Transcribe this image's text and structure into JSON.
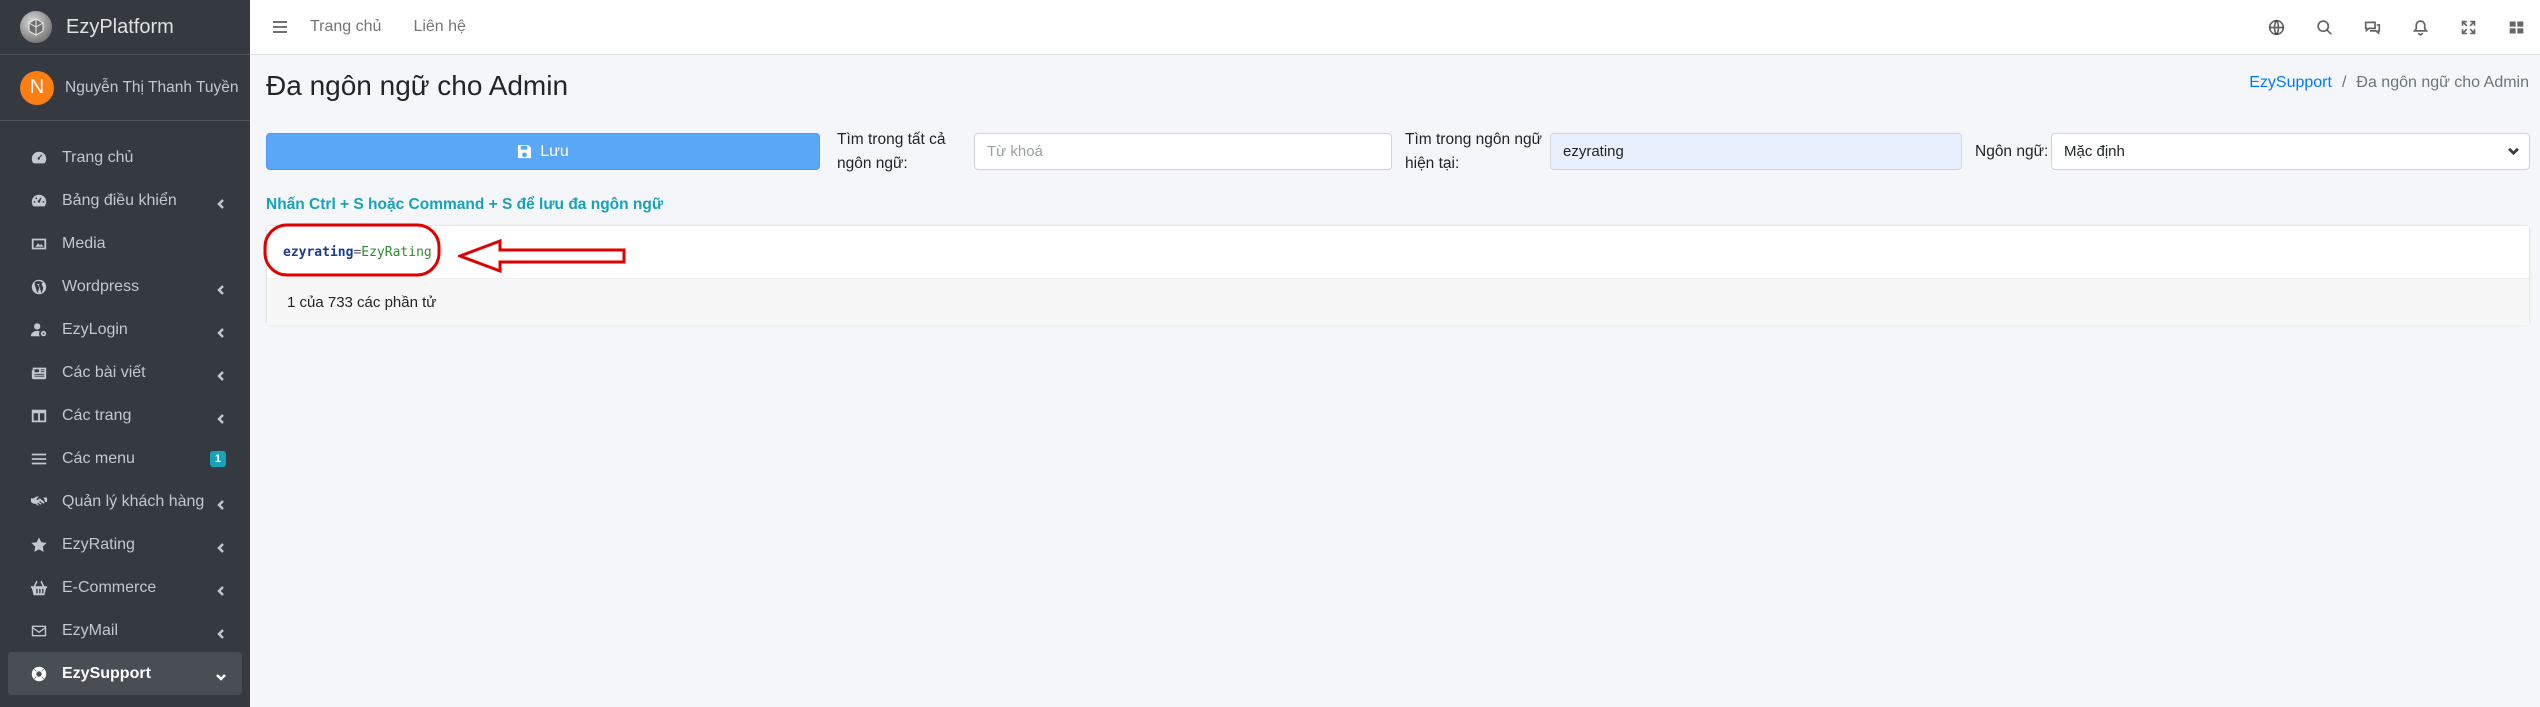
{
  "brand": {
    "name": "EzyPlatform"
  },
  "user": {
    "initial": "N",
    "name": "Nguyễn Thị Thanh Tuyền"
  },
  "sidebar": {
    "items": [
      {
        "label": "Trang chủ",
        "icon": "tachometer-icon"
      },
      {
        "label": "Bảng điều khiển",
        "icon": "dashboard-icon"
      },
      {
        "label": "Media",
        "icon": "image-icon"
      },
      {
        "label": "Wordpress",
        "icon": "wordpress-icon"
      },
      {
        "label": "EzyLogin",
        "icon": "user-cog-icon"
      },
      {
        "label": "Các bài viết",
        "icon": "newspaper-icon"
      },
      {
        "label": "Các trang",
        "icon": "columns-icon"
      },
      {
        "label": "Các menu",
        "icon": "bars-icon",
        "badge": "1"
      },
      {
        "label": "Quản lý khách hàng",
        "icon": "handshake-icon"
      },
      {
        "label": "EzyRating",
        "icon": "star-icon"
      },
      {
        "label": "E-Commerce",
        "icon": "basket-icon"
      },
      {
        "label": "EzyMail",
        "icon": "envelope-icon"
      },
      {
        "label": "EzySupport",
        "icon": "life-ring-icon"
      }
    ]
  },
  "navbar": {
    "links": [
      "Trang chủ",
      "Liên hệ"
    ],
    "icons": [
      "globe-icon",
      "search-icon",
      "comments-icon",
      "bell-icon",
      "expand-icon",
      "grid-icon"
    ]
  },
  "page": {
    "title": "Đa ngôn ngữ cho Admin",
    "breadcrumb": {
      "parent": "EzySupport",
      "separator": "/",
      "current": "Đa ngôn ngữ cho Admin"
    }
  },
  "toolbar": {
    "save_label": "Lưu",
    "search_all_label": "Tìm trong tất cả ngôn ngữ:",
    "search_all_placeholder": "Từ khoá",
    "search_current_label": "Tìm trong ngôn ngữ hiện tại:",
    "search_current_value": "ezyrating",
    "language_label": "Ngôn ngữ:",
    "language_value": "Mặc định"
  },
  "hint": "Nhấn Ctrl + S hoặc Command + S để lưu đa ngôn ngữ",
  "entries": [
    {
      "key": "ezyrating",
      "eq": "=",
      "value": "EzyRating"
    }
  ],
  "pagination_text": "1 của 733 các phần tử",
  "colors": {
    "sidebar": "#343a40",
    "primary": "#007bff",
    "info": "#17a2b8",
    "annotation": "#e00000"
  }
}
